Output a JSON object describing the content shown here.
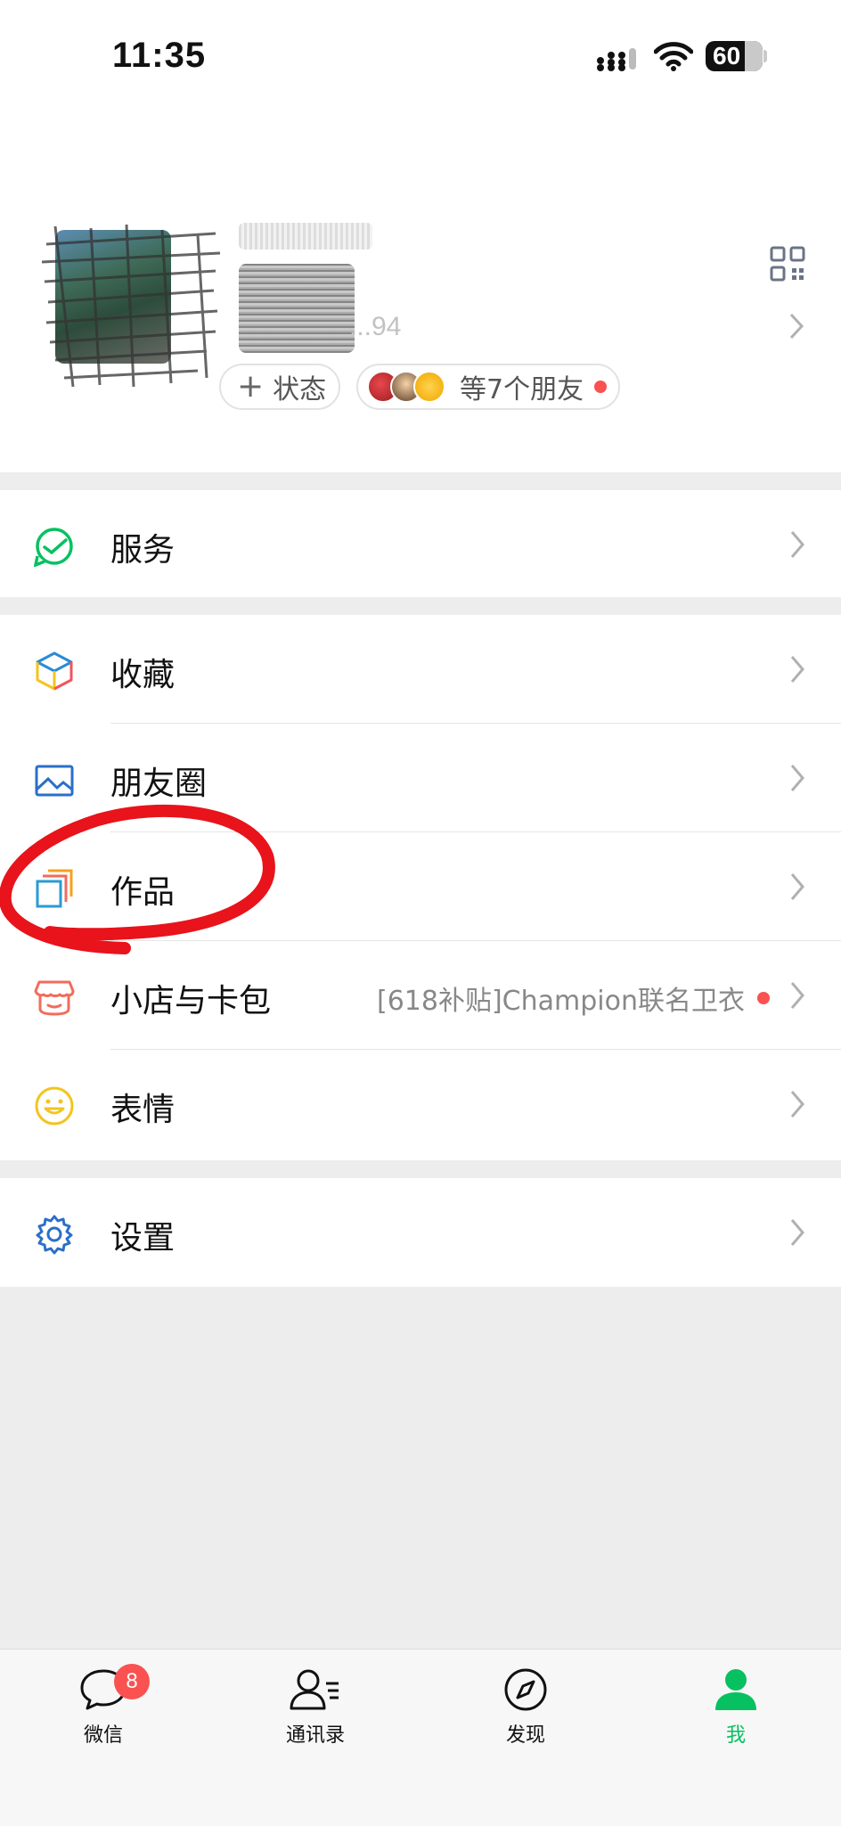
{
  "status_bar": {
    "time": "11:35",
    "battery": "60"
  },
  "profile": {
    "wxid_partial": "...94",
    "status_label": "状态",
    "friends_label": "等7个朋友"
  },
  "menu": {
    "services": "服务",
    "favorites": "收藏",
    "moments": "朋友圈",
    "works": "作品",
    "store": "小店与卡包",
    "store_promo": "[618补贴]Champion联名卫衣",
    "stickers": "表情",
    "settings": "设置"
  },
  "tabs": [
    {
      "label": "微信",
      "icon": "chat-icon",
      "badge": "8"
    },
    {
      "label": "通讯录",
      "icon": "contacts-icon"
    },
    {
      "label": "发现",
      "icon": "compass-icon"
    },
    {
      "label": "我",
      "icon": "person-icon",
      "active": true
    }
  ],
  "colors": {
    "accent": "#07c160",
    "badge": "#fa5151",
    "annotation": "#e8131b"
  }
}
